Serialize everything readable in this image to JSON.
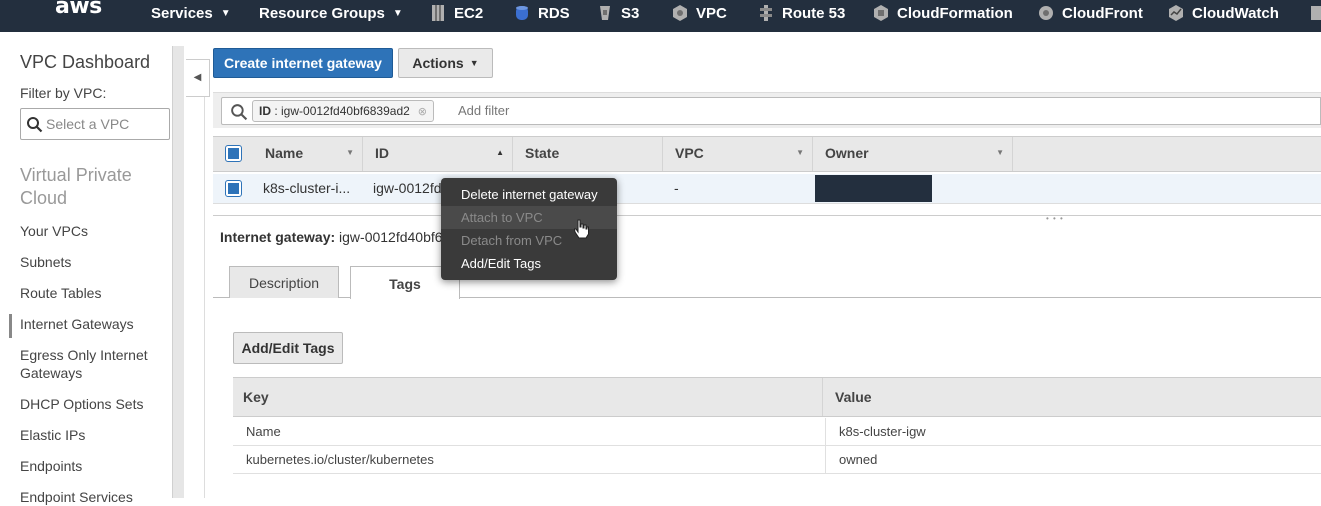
{
  "topnav": {
    "logo": "aws",
    "services": "Services",
    "resource_groups": "Resource Groups",
    "shortcuts": [
      {
        "label": "EC2",
        "icon": "ec2-icon",
        "color": "#b0b0b0"
      },
      {
        "label": "RDS",
        "icon": "rds-icon",
        "color": "#3b6fd1"
      },
      {
        "label": "S3",
        "icon": "s3-icon",
        "color": "#b0b0b0"
      },
      {
        "label": "VPC",
        "icon": "vpc-icon",
        "color": "#b0b0b0"
      },
      {
        "label": "Route 53",
        "icon": "route53-icon",
        "color": "#b0b0b0"
      },
      {
        "label": "CloudFormation",
        "icon": "cloudformation-icon",
        "color": "#b0b0b0"
      },
      {
        "label": "CloudFront",
        "icon": "cloudfront-icon",
        "color": "#b0b0b0"
      },
      {
        "label": "CloudWatch",
        "icon": "cloudwatch-icon",
        "color": "#b0b0b0"
      }
    ]
  },
  "sidebar": {
    "title": "VPC Dashboard",
    "filter_label": "Filter by VPC:",
    "select_placeholder": "Select a VPC",
    "section_title": "Virtual Private Cloud",
    "items": [
      {
        "label": "Your VPCs",
        "active": false
      },
      {
        "label": "Subnets",
        "active": false
      },
      {
        "label": "Route Tables",
        "active": false
      },
      {
        "label": "Internet Gateways",
        "active": true
      },
      {
        "label": "Egress Only Internet Gateways",
        "active": false
      },
      {
        "label": "DHCP Options Sets",
        "active": false
      },
      {
        "label": "Elastic IPs",
        "active": false
      },
      {
        "label": "Endpoints",
        "active": false
      },
      {
        "label": "Endpoint Services",
        "active": false
      }
    ]
  },
  "toolbar": {
    "create_label": "Create internet gateway",
    "actions_label": "Actions"
  },
  "filter": {
    "token_key": "ID",
    "token_value": "igw-0012fd40bf6839ad2",
    "add_placeholder": "Add filter"
  },
  "grid": {
    "columns": [
      "Name",
      "ID",
      "State",
      "VPC",
      "Owner"
    ],
    "row": {
      "name": "k8s-cluster-i...",
      "id": "igw-0012fd",
      "state": "",
      "vpc": "-",
      "owner": ""
    }
  },
  "details": {
    "igw_label": "Internet gateway:",
    "igw_value": "igw-0012fd40bf6",
    "tabs": [
      "Description",
      "Tags"
    ],
    "active_tab": "Tags",
    "add_tags_label": "Add/Edit Tags",
    "tags_columns": [
      "Key",
      "Value"
    ],
    "tags": [
      {
        "key": "Name",
        "value": "k8s-cluster-igw"
      },
      {
        "key": "kubernetes.io/cluster/kubernetes",
        "value": "owned"
      }
    ]
  },
  "context_menu": {
    "items": [
      {
        "label": "Delete internet gateway",
        "disabled": false
      },
      {
        "label": "Attach to VPC",
        "disabled": true
      },
      {
        "label": "Detach from VPC",
        "disabled": true
      },
      {
        "label": "Add/Edit Tags",
        "disabled": false
      }
    ]
  },
  "colors": {
    "nav_bg": "#232f3e",
    "primary_button": "#2e73b8",
    "menu_bg": "#3a3a3a"
  }
}
